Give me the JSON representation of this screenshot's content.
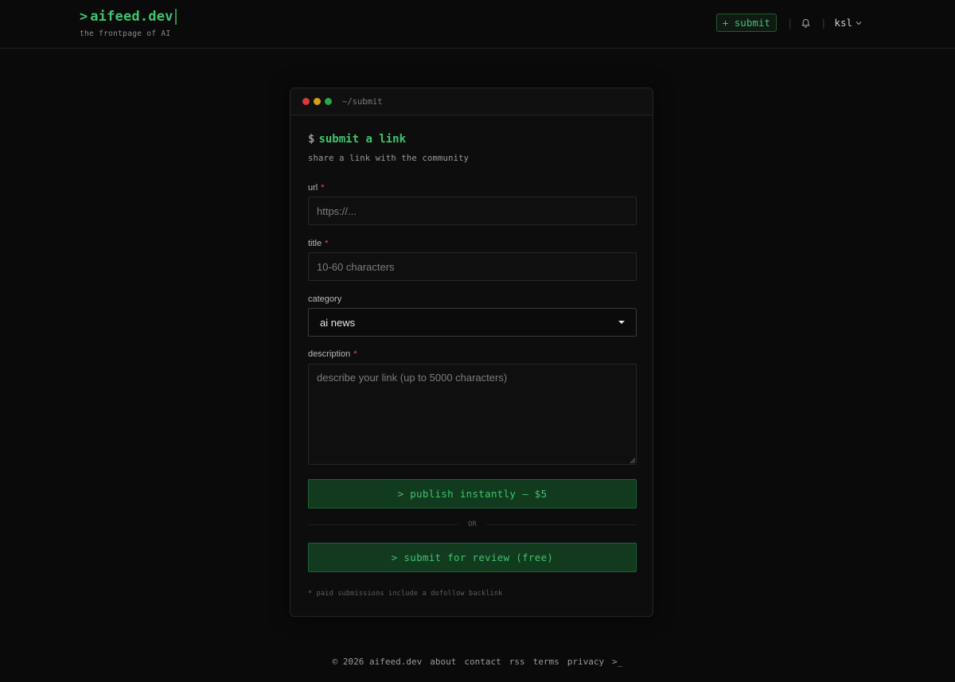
{
  "header": {
    "logo_prompt": ">",
    "logo_name": "aifeed.dev",
    "tagline": "the frontpage of AI",
    "submit_label": "+ submit",
    "separator": "|",
    "username": "ksl"
  },
  "window": {
    "path": "~/submit",
    "dot_colors": [
      "#d73a3a",
      "#d4a21a",
      "#28a745"
    ]
  },
  "form": {
    "heading_prefix": "$",
    "heading": "submit a link",
    "subheading": "share a link with the community",
    "url_label": "url",
    "url_placeholder": "https://...",
    "title_label": "title",
    "title_placeholder": "10-60 characters",
    "category_label": "category",
    "category_value": "ai news",
    "description_label": "description",
    "description_placeholder": "describe your link (up to 5000 characters)",
    "required_mark": "*",
    "publish_label": "> publish instantly — $5",
    "or_label": "OR",
    "review_label": "> submit for review (free)",
    "footnote": "* paid submissions include a dofollow backlink"
  },
  "footer": {
    "copyright": "© 2026 aifeed.dev",
    "links": [
      "about",
      "contact",
      "rss",
      "terms",
      "privacy"
    ],
    "prompt": ">_"
  },
  "colors": {
    "accent": "#3ec46d",
    "background": "#0a0a0a",
    "required": "#e05252"
  }
}
